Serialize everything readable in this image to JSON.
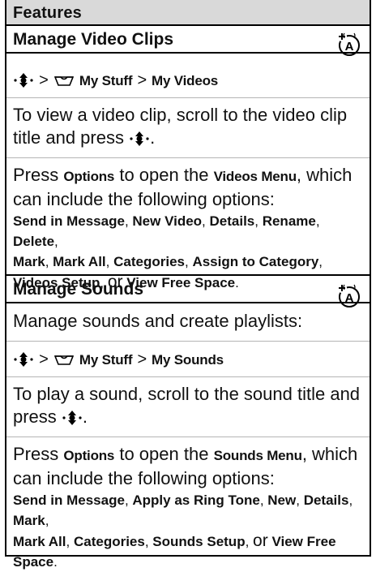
{
  "header": {
    "title": "Features"
  },
  "section1": {
    "title": "Manage Video Clips",
    "path": {
      "sep1": ">",
      "item1": "My Stuff",
      "sep2": ">",
      "item2": "My Videos"
    },
    "para1": {
      "text": "To view a video clip, scroll to the video clip title and press",
      "end": "."
    },
    "para2": {
      "press": "Press",
      "options_key": "Options",
      "mid": "to open the",
      "menu_name": "Videos Menu",
      "tail": ", which can include the following options:",
      "options": [
        "Send in Message",
        "New Video",
        "Details",
        "Rename",
        "Delete",
        "Mark",
        "Mark All",
        "Categories",
        "Assign to Category",
        "Videos Setup",
        "View Free Space"
      ],
      "or": "or"
    }
  },
  "section2": {
    "title": "Manage Sounds",
    "intro": "Manage sounds and create playlists:",
    "path": {
      "sep1": ">",
      "item1": "My Stuff",
      "sep2": ">",
      "item2": "My Sounds"
    },
    "para1": {
      "text": "To play a sound, scroll to the sound title and press",
      "end": "."
    },
    "para2": {
      "press": "Press",
      "options_key": "Options",
      "mid": "to open the",
      "menu_name": "Sounds Menu",
      "tail": ", which can include the following options:",
      "options": [
        "Send in Message",
        "Apply as Ring Tone",
        "New",
        "Details",
        "Mark",
        "Mark All",
        "Categories",
        "Sounds Setup",
        "View Free Space"
      ],
      "or": "or"
    }
  },
  "icons": {
    "nav_key": "navigation-key-icon",
    "my_stuff": "tray-icon",
    "network": "network-feature-icon"
  }
}
